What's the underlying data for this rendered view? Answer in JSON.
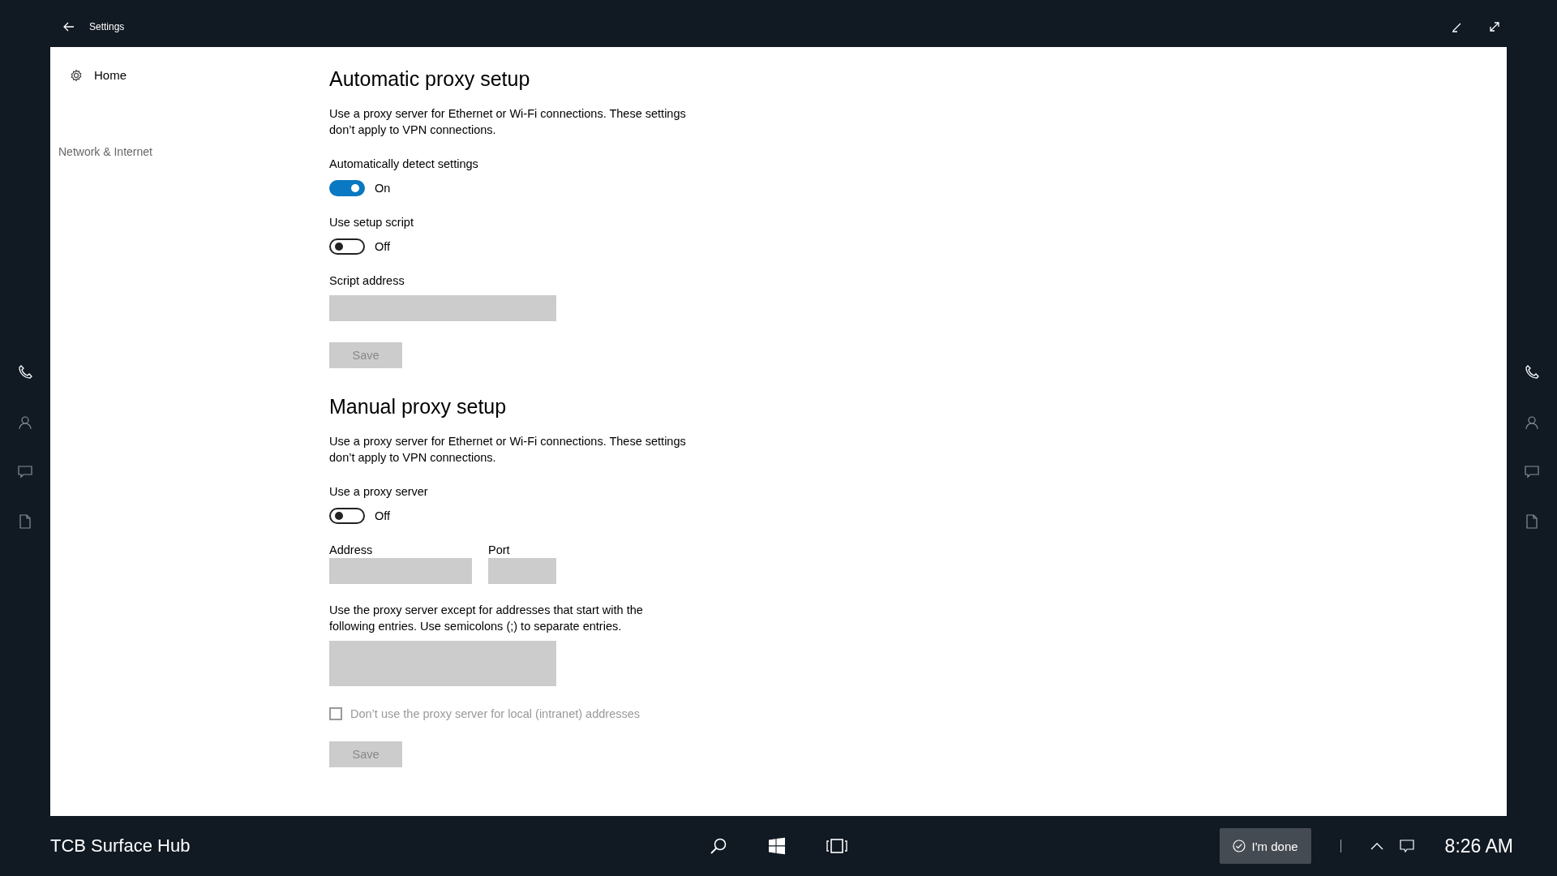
{
  "window": {
    "title": "Settings"
  },
  "sidebar": {
    "home": "Home",
    "section": "Network & Internet"
  },
  "sections": [
    {
      "title": "Automatic proxy setup",
      "description": "Use a proxy server for Ethernet or Wi-Fi connections. These settings don’t apply to VPN connections.",
      "controls": [
        {
          "kind": "toggle",
          "label": "Automatically detect settings",
          "on": true,
          "state_text": "On"
        },
        {
          "kind": "toggle",
          "label": "Use setup script",
          "on": false,
          "state_text": "Off"
        },
        {
          "kind": "field",
          "label": "Script address",
          "disabled": true
        },
        {
          "kind": "button",
          "label": "Save",
          "disabled": true
        }
      ]
    },
    {
      "title": "Manual proxy setup",
      "description": "Use a proxy server for Ethernet or Wi-Fi connections. These settings don’t apply to VPN connections.",
      "controls": [
        {
          "kind": "toggle",
          "label": "Use a proxy server",
          "on": false,
          "state_text": "Off"
        },
        {
          "kind": "field_pair",
          "fields": [
            {
              "label": "Address",
              "disabled": true
            },
            {
              "label": "Port",
              "disabled": true
            }
          ]
        },
        {
          "kind": "textarea",
          "label": "Use the proxy server except for addresses that start with the following entries. Use semicolons (;) to separate entries.",
          "disabled": true
        },
        {
          "kind": "checkbox",
          "label": "Don’t use the proxy server for local (intranet) addresses",
          "checked": false,
          "disabled": true
        },
        {
          "kind": "button",
          "label": "Save",
          "disabled": true
        }
      ]
    }
  ],
  "taskbar": {
    "device_name": "TCB Surface Hub",
    "done_button": "I'm done",
    "time": "8:26 AM"
  }
}
